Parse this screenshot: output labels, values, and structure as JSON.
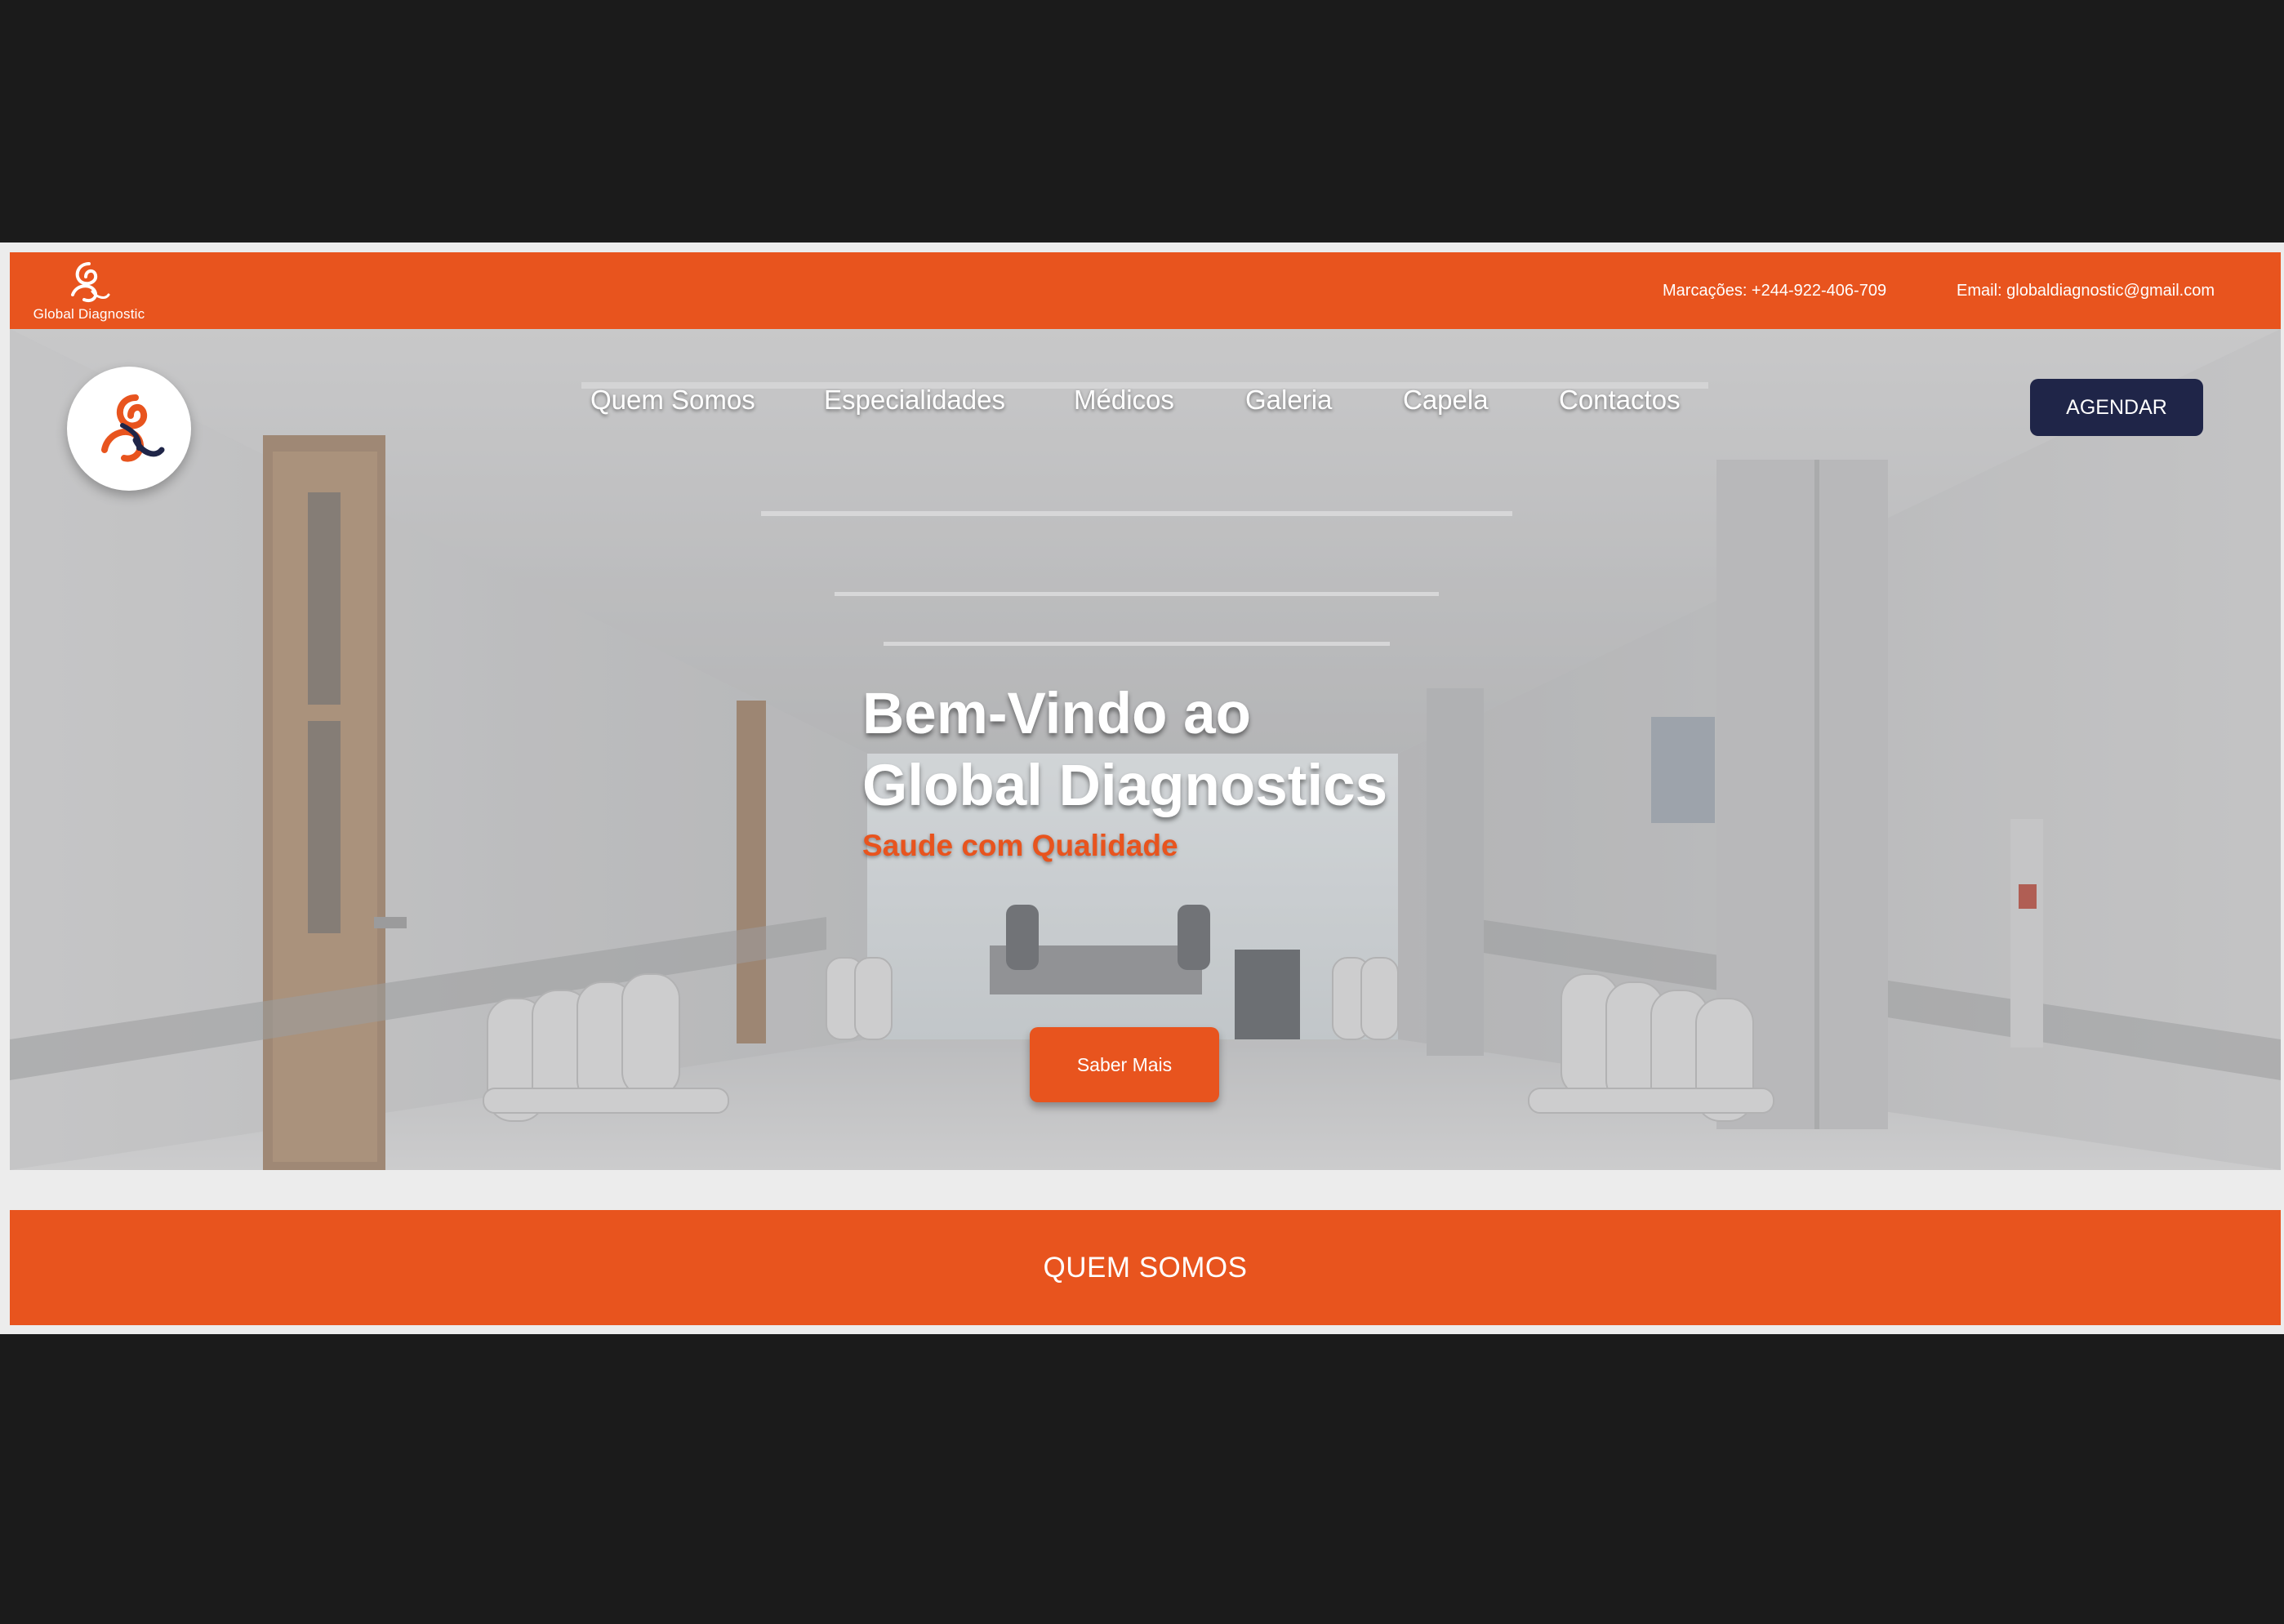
{
  "brand": {
    "name": "Global Diagnostic",
    "accent_color": "#e8541e",
    "navy_color": "#1f2548",
    "logo_icon": "swirl-logo-icon"
  },
  "topbar": {
    "phone": "Marcações: +244-922-406-709",
    "email": "Email: globaldiagnostic@gmail.com"
  },
  "nav": {
    "items": [
      {
        "label": "Quem Somos"
      },
      {
        "label": "Especialidades"
      },
      {
        "label": "Médicos"
      },
      {
        "label": "Galeria"
      },
      {
        "label": "Capela"
      },
      {
        "label": "Contactos"
      }
    ],
    "cta_label": "AGENDAR"
  },
  "hero": {
    "title_line1": "Bem-Vindo ao",
    "title_line2": "Global Diagnostics",
    "subtitle": "Saude com Qualidade",
    "button_label": "Saber Mais",
    "background": "hospital-corridor-photo"
  },
  "section": {
    "title": "QUEM SOMOS"
  }
}
